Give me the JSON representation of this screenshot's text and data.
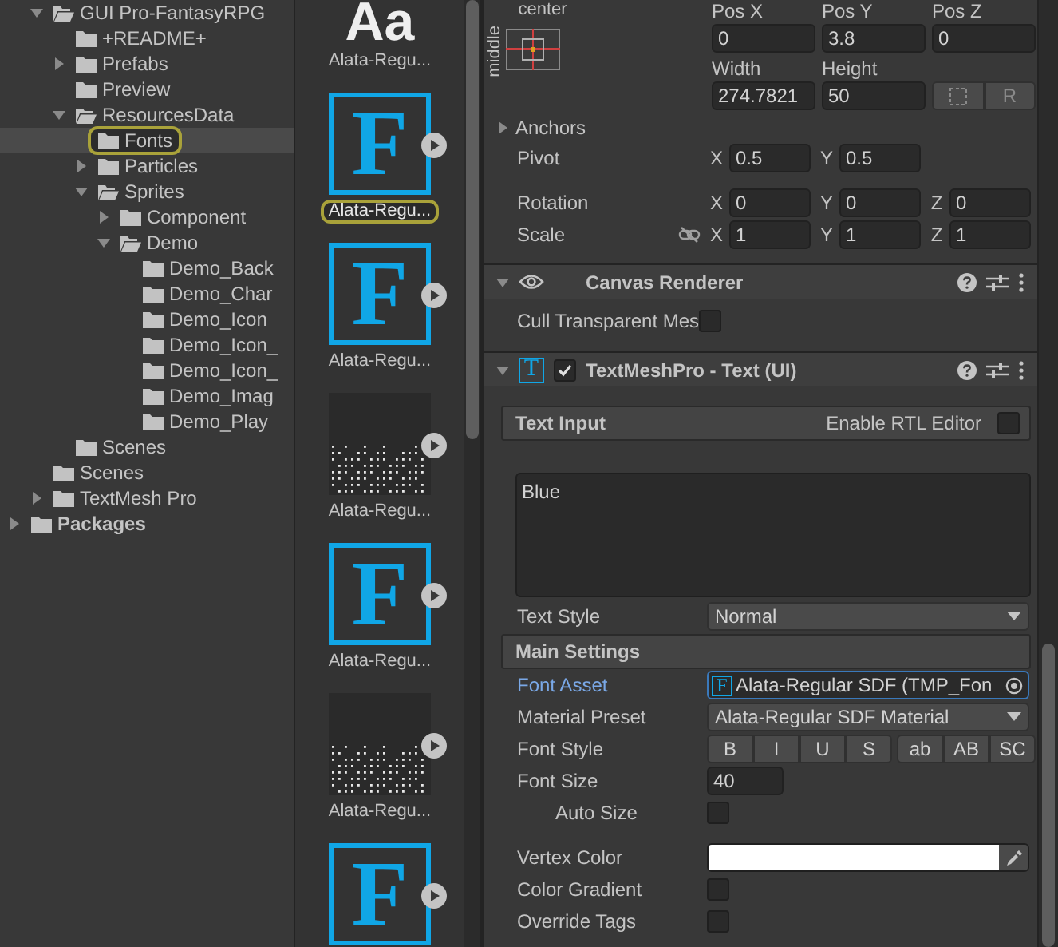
{
  "project_tree": {
    "items": [
      {
        "label": "GUI Pro-FantasyRPG",
        "expanded": true,
        "selected": false,
        "children": [
          {
            "label": "+README+",
            "selected": false
          },
          {
            "label": "Prefabs",
            "expanded": false,
            "selected": false
          },
          {
            "label": "Preview",
            "selected": false
          },
          {
            "label": "ResourcesData",
            "expanded": true,
            "selected": false,
            "children": [
              {
                "label": "Fonts",
                "selected": true
              },
              {
                "label": "Particles",
                "expanded": false,
                "selected": false
              },
              {
                "label": "Sprites",
                "expanded": true,
                "selected": false,
                "children": [
                  {
                    "label": "Component",
                    "expanded": false,
                    "selected": false
                  },
                  {
                    "label": "Demo",
                    "expanded": true,
                    "selected": false,
                    "children": [
                      {
                        "label": "Demo_Back",
                        "selected": false
                      },
                      {
                        "label": "Demo_Char",
                        "selected": false
                      },
                      {
                        "label": "Demo_Icon",
                        "selected": false
                      },
                      {
                        "label": "Demo_Icon_",
                        "selected": false
                      },
                      {
                        "label": "Demo_Icon_",
                        "selected": false
                      },
                      {
                        "label": "Demo_Imag",
                        "selected": false
                      },
                      {
                        "label": "Demo_Play",
                        "selected": false
                      }
                    ]
                  }
                ]
              }
            ]
          },
          {
            "label": "Scenes",
            "selected": false
          }
        ]
      },
      {
        "label": "Scenes",
        "selected": false
      },
      {
        "label": "TextMesh Pro",
        "expanded": false,
        "selected": false
      }
    ],
    "root": {
      "label": "Packages",
      "expanded": false,
      "selected": false
    }
  },
  "assets": [
    {
      "kind": "font-preview",
      "preview": "Aa",
      "label": "Alata-Regu...",
      "selected": false
    },
    {
      "kind": "font-asset",
      "glyph": "F",
      "label": "Alata-Regu...",
      "selected": true
    },
    {
      "kind": "font-asset",
      "glyph": "F",
      "label": "Alata-Regu...",
      "selected": false
    },
    {
      "kind": "atlas",
      "label": "Alata-Regu...",
      "selected": false
    },
    {
      "kind": "font-asset",
      "glyph": "F",
      "label": "Alata-Regu...",
      "selected": false
    },
    {
      "kind": "atlas",
      "label": "Alata-Regu...",
      "selected": false
    },
    {
      "kind": "font-asset",
      "glyph": "F",
      "selected": false
    }
  ],
  "rect_transform": {
    "anchor_horizontal": "center",
    "anchor_vertical": "middle",
    "position": [
      {
        "label": "Pos X",
        "value": "0"
      },
      {
        "label": "Pos Y",
        "value": "3.8"
      },
      {
        "label": "Pos Z",
        "value": "0"
      }
    ],
    "size": [
      {
        "label": "Width",
        "value": "274.7821"
      },
      {
        "label": "Height",
        "value": "50"
      }
    ],
    "raw_button": "R",
    "anchors": {
      "label": "Anchors",
      "expanded": false
    },
    "vectors": [
      {
        "label": "Pivot",
        "axes": [
          {
            "axis": "X",
            "value": "0.5"
          },
          {
            "axis": "Y",
            "value": "0.5"
          }
        ]
      },
      {
        "label": "Rotation",
        "axes": [
          {
            "axis": "X",
            "value": "0"
          },
          {
            "axis": "Y",
            "value": "0"
          },
          {
            "axis": "Z",
            "value": "0"
          }
        ]
      },
      {
        "label": "Scale",
        "linked": false,
        "axes": [
          {
            "axis": "X",
            "value": "1"
          },
          {
            "axis": "Y",
            "value": "1"
          },
          {
            "axis": "Z",
            "value": "1"
          }
        ]
      }
    ]
  },
  "canvas_renderer": {
    "title": "Canvas Renderer",
    "expanded": true,
    "cull": {
      "label": "Cull Transparent Mes",
      "checked": false
    }
  },
  "textmeshpro": {
    "title": "TextMeshPro - Text (UI)",
    "icon_glyph": "T",
    "expanded": true,
    "enabled": true,
    "text_input": {
      "title": "Text Input",
      "rtl_label": "Enable RTL Editor",
      "rtl_checked": false,
      "value": "Blue"
    },
    "text_style": {
      "label": "Text Style",
      "value": "Normal"
    },
    "main_settings": "Main Settings",
    "rows": [
      {
        "kind": "object",
        "label": "Font Asset",
        "icon_glyph": "F",
        "value": "Alata-Regular SDF (TMP_Fon",
        "focused": true
      },
      {
        "kind": "dropdown",
        "label": "Material Preset",
        "value": "Alata-Regular SDF Material"
      },
      {
        "kind": "buttons",
        "label": "Font Style",
        "buttons": [
          {
            "label": "B",
            "selected": false
          },
          {
            "label": "I",
            "selected": false
          },
          {
            "label": "U",
            "selected": false
          },
          {
            "label": "S",
            "selected": false
          },
          {
            "label": "ab",
            "selected": false
          },
          {
            "label": "AB",
            "selected": false
          },
          {
            "label": "SC",
            "selected": false
          }
        ]
      },
      {
        "kind": "number",
        "label": "Font Size",
        "value": "40",
        "children": [
          {
            "kind": "checkbox",
            "label": "Auto Size",
            "checked": false
          }
        ]
      },
      {
        "kind": "color",
        "label": "Vertex Color",
        "color": "#ffffff"
      },
      {
        "kind": "checkbox",
        "label": "Color Gradient",
        "checked": false
      },
      {
        "kind": "checkbox",
        "label": "Override Tags",
        "checked": false
      }
    ]
  }
}
